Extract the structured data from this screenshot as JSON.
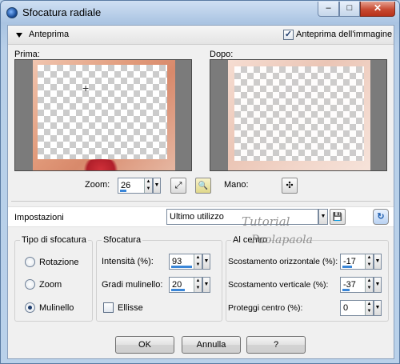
{
  "window": {
    "title": "Sfocatura radiale",
    "buttons": {
      "minimize": "–",
      "maximize": "□",
      "close": "✕"
    }
  },
  "preview": {
    "header_label": "Anteprima",
    "show_image_label": "Anteprima dell'immagine",
    "show_image_checked": true,
    "before_label": "Prima:",
    "after_label": "Dopo:",
    "zoom_label": "Zoom:",
    "zoom_value": "26",
    "zoom_level_fraction": 0.3,
    "pan_label": "Mano:",
    "pan_glyph": "✣",
    "crosshair_glyph": "+",
    "zoom_fit_glyph": "⤢",
    "zoom_tool_glyph": "🔍"
  },
  "presets": {
    "label": "Impostazioni",
    "value": "Ultimo utilizzo",
    "save_glyph": "💾",
    "reset_glyph": "↻"
  },
  "blur_type": {
    "title": "Tipo di sfocatura",
    "options": [
      {
        "label": "Rotazione",
        "selected": false
      },
      {
        "label": "Zoom",
        "selected": false
      },
      {
        "label": "Mulinello",
        "selected": true
      }
    ]
  },
  "blur": {
    "title": "Sfocatura",
    "intensity_label": "Intensità (%):",
    "intensity_value": "93",
    "intensity_fraction": 0.93,
    "twirl_label": "Gradi mulinello:",
    "twirl_value": "20",
    "twirl_fraction": 0.6,
    "ellipse_label": "Ellisse",
    "ellipse_checked": false
  },
  "center": {
    "title": "Al centro",
    "h_offset_label": "Scostamento orizzontale (%):",
    "h_offset_value": "-17",
    "h_offset_fraction": 0.42,
    "v_offset_label": "Scostamento verticale (%):",
    "v_offset_value": "-37",
    "v_offset_fraction": 0.32,
    "protect_label": "Proteggi centro (%):",
    "protect_value": "0",
    "protect_fraction": 0.0
  },
  "footer": {
    "ok": "OK",
    "cancel": "Annulla",
    "help": "?"
  },
  "watermark": {
    "line1": "Tutorial",
    "line2": "Paolapaola"
  },
  "colors": {
    "accent_blue": "#3a86d8",
    "close_red": "#c74a32",
    "pane_gray": "#7b7b7b",
    "frame_orange": "#e19a7a"
  }
}
